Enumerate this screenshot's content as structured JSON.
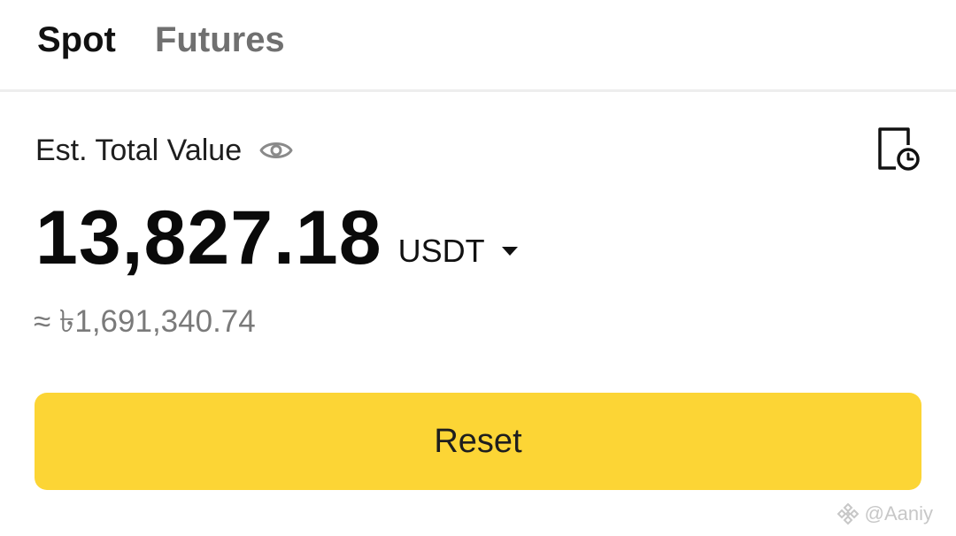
{
  "tabs": [
    {
      "label": "Spot",
      "active": true
    },
    {
      "label": "Futures",
      "active": false
    }
  ],
  "summary": {
    "label": "Est. Total Value",
    "visibility_icon": "eye-icon",
    "history_icon": "history-clock-icon",
    "balance": "13,827.18",
    "currency": "USDT",
    "fiat_equivalent": "≈ ৳1,691,340.74"
  },
  "actions": {
    "reset_label": "Reset"
  },
  "watermark": {
    "text": "@Aaniy"
  },
  "colors": {
    "accent": "#fcd535",
    "text_primary": "#111111",
    "text_muted": "#707070"
  }
}
